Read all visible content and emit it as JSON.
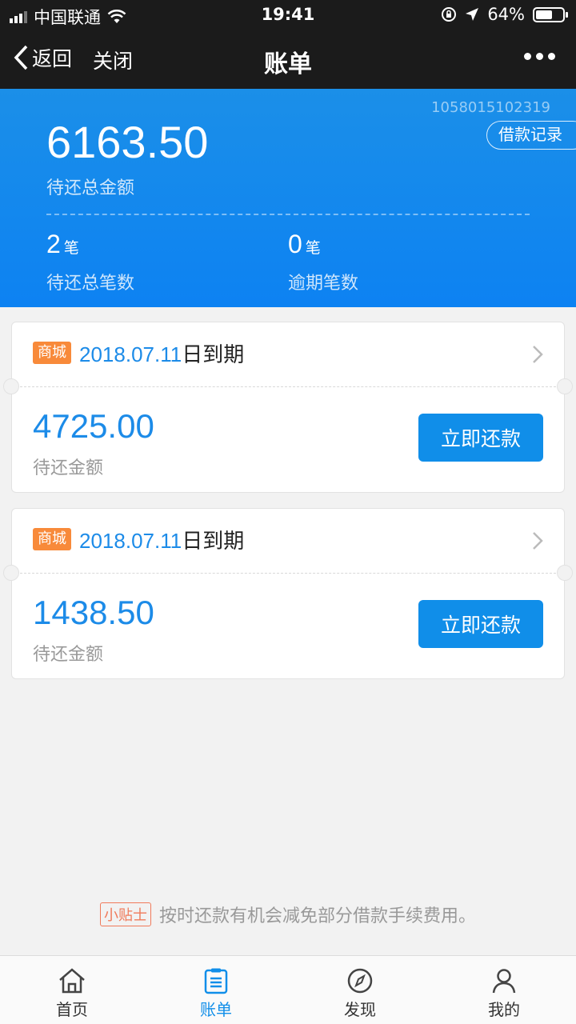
{
  "status": {
    "carrier": "中国联通",
    "time": "19:41",
    "battery": "64%",
    "battery_level": 0.64
  },
  "nav": {
    "back": "返回",
    "close": "关闭",
    "title": "账单"
  },
  "summary": {
    "account_no": "1058015102319",
    "records_button": "借款记录",
    "total_amount": "6163.50",
    "total_label": "待还总金额",
    "pending_count": "2",
    "pending_unit": "笔",
    "pending_label": "待还总笔数",
    "overdue_count": "0",
    "overdue_unit": "笔",
    "overdue_label": "逾期笔数"
  },
  "bills": [
    {
      "tag": "商城",
      "due_date": "2018.07.11",
      "due_suffix": "日到期",
      "amount": "4725.00",
      "amount_label": "待还金额",
      "pay_button": "立即还款"
    },
    {
      "tag": "商城",
      "due_date": "2018.07.11",
      "due_suffix": "日到期",
      "amount": "1438.50",
      "amount_label": "待还金额",
      "pay_button": "立即还款"
    }
  ],
  "tip": {
    "badge": "小贴士",
    "text": "按时还款有机会减免部分借款手续费用。"
  },
  "tabs": [
    {
      "label": "首页",
      "icon": "home-icon"
    },
    {
      "label": "账单",
      "icon": "bill-icon",
      "active": true
    },
    {
      "label": "发现",
      "icon": "compass-icon"
    },
    {
      "label": "我的",
      "icon": "user-icon"
    }
  ],
  "colors": {
    "accent": "#108ee9",
    "tag": "#f88a3a",
    "header_bg": "#1b1b1b"
  }
}
